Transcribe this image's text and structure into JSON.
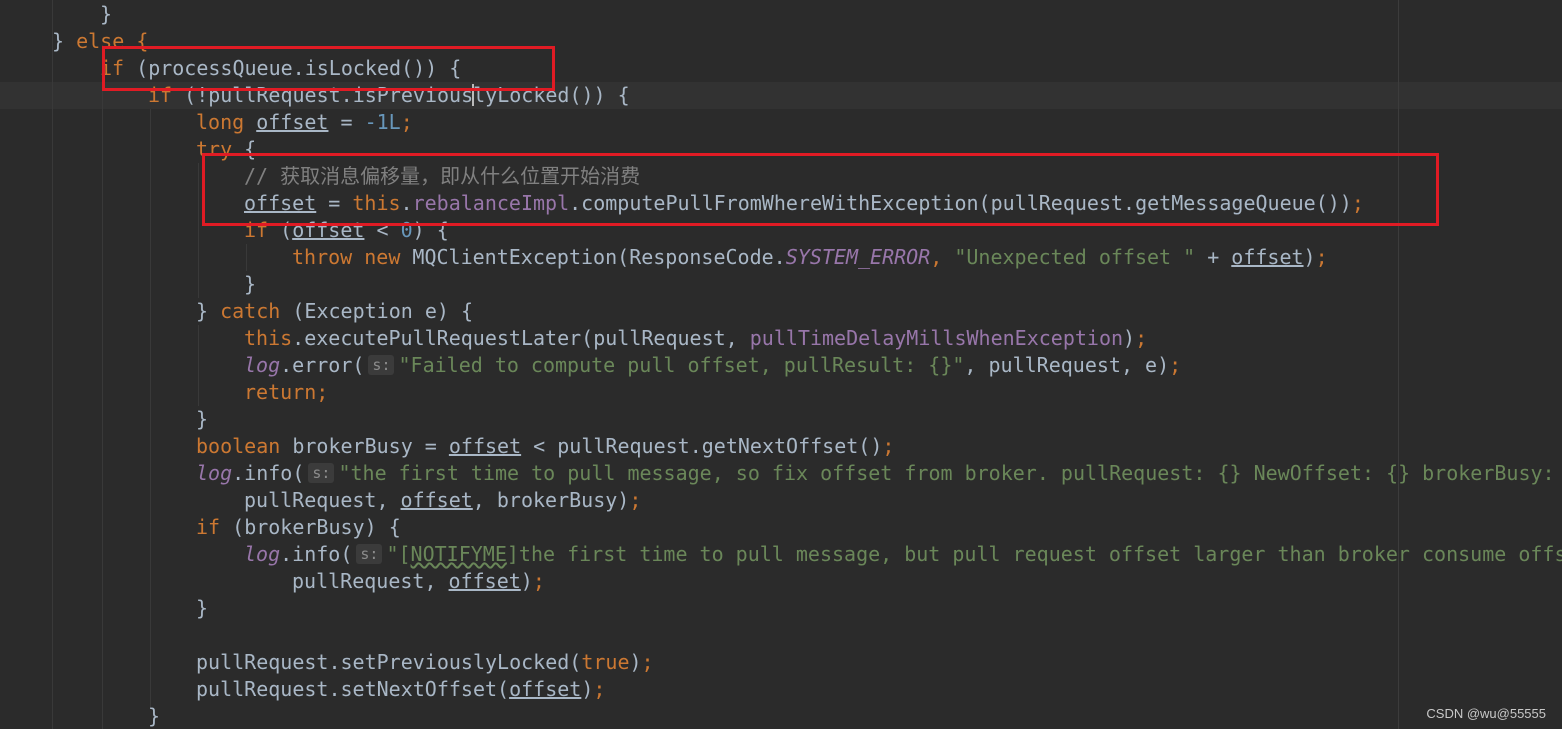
{
  "watermark": "CSDN @wu@55555",
  "lines": {
    "l01": "}",
    "l02_close": "}",
    "l02_else": "else",
    "l02_open": "{",
    "l03_if": "if",
    "l03_expr": "processQueue.isLocked",
    "l03_open": "{",
    "l04_if": "if",
    "l04_expr_a": "!pullRequest.isPrevious",
    "l04_expr_b": "lyLocked",
    "l04_open": "{",
    "l05_type": "long",
    "l05_var": "offset",
    "l05_op": " = ",
    "l05_num": "-1L",
    "l05_end": ";",
    "l06_try": "try",
    "l06_open": "{",
    "l07_comment": "// 获取消息偏移量，即从什么位置开始消费",
    "l08_var": "offset",
    "l08_op": " = ",
    "l08_this": "this",
    "l08_dot": ".",
    "l08_field": "rebalanceImpl",
    "l08_call": ".computePullFromWhereWithException",
    "l08_arg": "pullRequest.getMessageQueue",
    "l08_end": ";",
    "l09_if": "if",
    "l09_var": "offset",
    "l09_op": " < ",
    "l09_num": "0",
    "l09_open": "{",
    "l10_throw": "throw",
    "l10_new": "new",
    "l10_cls": " MQClientException",
    "l10_rc": "ResponseCode.",
    "l10_const": "SYSTEM_ERROR",
    "l10_comma": ", ",
    "l10_str": "\"Unexpected offset \"",
    "l10_plus": " + ",
    "l10_var": "offset",
    "l10_end": ";",
    "l11": "}",
    "l12_close": "}",
    "l12_catch": "catch",
    "l12_exc": "Exception e",
    "l12_open": "{",
    "l13_this": "this",
    "l13_call": ".executePullRequestLater",
    "l13_arg": "pullRequest, ",
    "l13_field": "pullTimeDelayMillsWhenException",
    "l13_end": ";",
    "l14_log": "log",
    "l14_call": ".error",
    "l14_hint": "s:",
    "l14_str": "\"Failed to compute pull offset, pullResult: {}\"",
    "l14_args": ", pullRequest, e",
    "l14_end": ";",
    "l15_return": "return",
    "l15_end": ";",
    "l16": "}",
    "l17_type": "boolean",
    "l17_var": " brokerBusy = ",
    "l17_off": "offset",
    "l17_rest": " < pullRequest.getNextOffset",
    "l17_end": ";",
    "l18_log": "log",
    "l18_call": ".info",
    "l18_hint": "s:",
    "l18_str": "\"the first time to pull message, so fix offset from broker. pullRequest: {} NewOffset: {} brokerBusy: {}\"",
    "l19_a": "pullRequest, ",
    "l19_off": "offset",
    "l19_b": ", brokerBusy",
    "l19_end": ";",
    "l20_if": "if",
    "l20_expr": "brokerBusy",
    "l20_open": "{",
    "l21_log": "log",
    "l21_call": ".info",
    "l21_hint": "s:",
    "l21_str_a": "\"[",
    "l21_typo": "NOTIFYME",
    "l21_str_b": "]the first time to pull message, but pull request offset larger than broker consume offset. pullRequest: {} NewOffset: {}\"",
    "l22_a": "pullRequest, ",
    "l22_off": "offset",
    "l22_end": ";",
    "l23": "}",
    "l25_a": "pullRequest.setPreviouslyLocked",
    "l25_true": "true",
    "l25_end": ";",
    "l26_a": "pullRequest.setNextOffset",
    "l26_off": "offset",
    "l26_end": ";",
    "l27": "}"
  }
}
